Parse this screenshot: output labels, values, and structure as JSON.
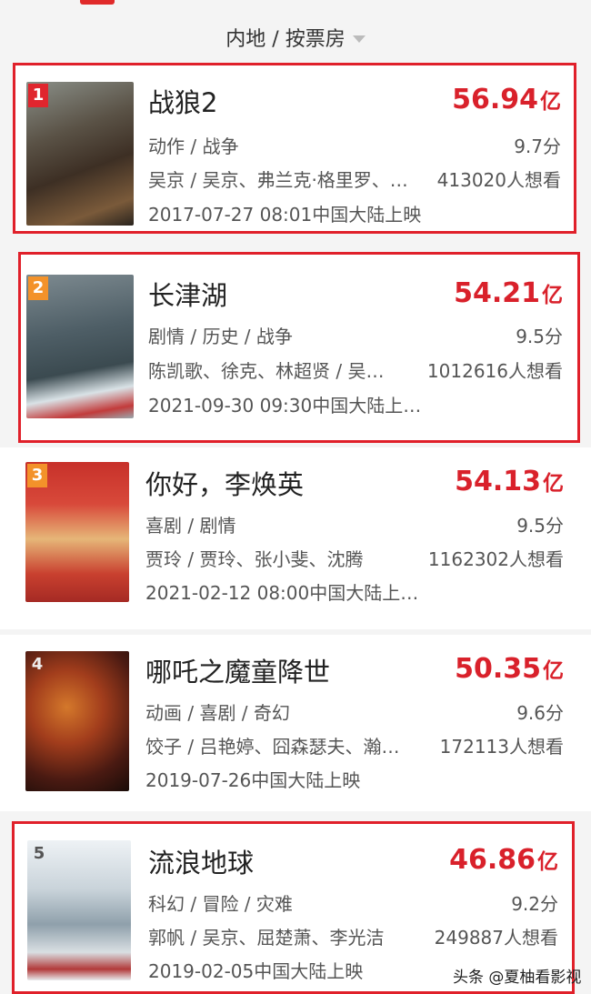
{
  "filter": {
    "label": "内地 / 按票房"
  },
  "movies": [
    {
      "rank": "1",
      "title": "战狼2",
      "box_num": "56.94",
      "box_unit": "亿",
      "genres": "动作 / 战争",
      "score": "9.7分",
      "cast": "吴京 / 吴京、弗兰克·格里罗、…",
      "wants": "413020人想看",
      "release": "2017-07-27 08:01中国大陆上映"
    },
    {
      "rank": "2",
      "title": "长津湖",
      "box_num": "54.21",
      "box_unit": "亿",
      "genres": "剧情 / 历史 / 战争",
      "score": "9.5分",
      "cast": "陈凯歌、徐克、林超贤 / 吴…",
      "wants": "1012616人想看",
      "release": "2021-09-30 09:30中国大陆上…"
    },
    {
      "rank": "3",
      "title": "你好，李焕英",
      "box_num": "54.13",
      "box_unit": "亿",
      "genres": "喜剧 / 剧情",
      "score": "9.5分",
      "cast": "贾玲 / 贾玲、张小斐、沈腾",
      "wants": "1162302人想看",
      "release": "2021-02-12 08:00中国大陆上…"
    },
    {
      "rank": "4",
      "title": "哪吒之魔童降世",
      "box_num": "50.35",
      "box_unit": "亿",
      "genres": "动画 / 喜剧 / 奇幻",
      "score": "9.6分",
      "cast": "饺子 / 吕艳婷、囧森瑟夫、瀚…",
      "wants": "172113人想看",
      "release": "2019-07-26中国大陆上映"
    },
    {
      "rank": "5",
      "title": "流浪地球",
      "box_num": "46.86",
      "box_unit": "亿",
      "genres": "科幻 / 冒险 / 灾难",
      "score": "9.2分",
      "cast": "郭帆 / 吴京、屈楚萧、李光洁",
      "wants": "249887人想看",
      "release": "2019-02-05中国大陆上映"
    }
  ],
  "watermark": "头条 @夏柚看影视",
  "colors": {
    "accent": "#d9212b",
    "highlight_border": "#e0202a",
    "rank1": "#e0262e",
    "rank2_3": "#f3922a"
  }
}
